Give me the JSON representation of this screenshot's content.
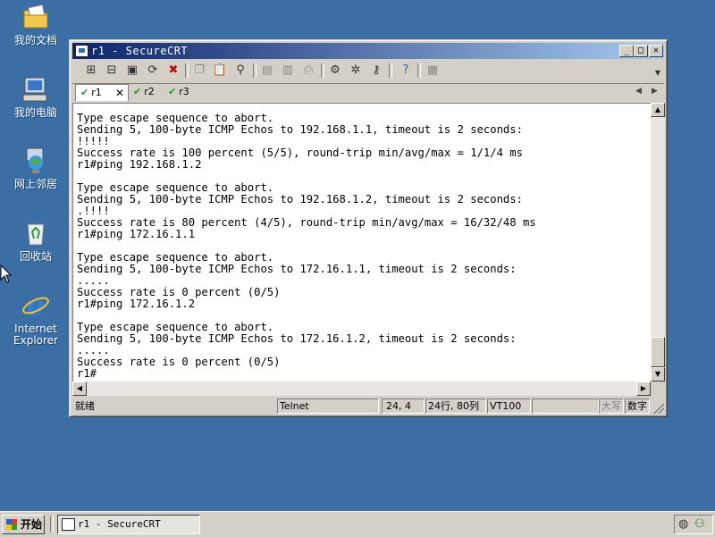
{
  "desktop": {
    "icons": [
      {
        "label": "我的文档",
        "icon": "my-documents-icon"
      },
      {
        "label": "我的电脑",
        "icon": "my-computer-icon"
      },
      {
        "label": "网上邻居",
        "icon": "network-places-icon"
      },
      {
        "label": "回收站",
        "icon": "recycle-bin-icon"
      },
      {
        "label": "Internet Explorer",
        "icon": "internet-explorer-icon"
      }
    ]
  },
  "window": {
    "title": "r1 - SecureCRT",
    "controls": {
      "minimize": "_",
      "maximize": "□",
      "close": "✕"
    }
  },
  "toolbar": {
    "icons": [
      "connect-icon",
      "quick-connect-icon",
      "connect-in-tab-icon",
      "reconnect-icon",
      "disconnect-icon",
      "copy-icon",
      "paste-icon",
      "find-icon",
      "print-icon",
      "print-preview-icon",
      "print-setup-icon",
      "session-options-icon",
      "global-options-icon",
      "keymap-icon",
      "help-icon",
      "keypad-icon"
    ]
  },
  "tabs": [
    {
      "label": "r1",
      "active": true,
      "close": "✕"
    },
    {
      "label": "r2",
      "active": false
    },
    {
      "label": "r3",
      "active": false
    }
  ],
  "terminal": {
    "lines": [
      "Type escape sequence to abort.",
      "Sending 5, 100-byte ICMP Echos to 192.168.1.1, timeout is 2 seconds:",
      "!!!!!",
      "Success rate is 100 percent (5/5), round-trip min/avg/max = 1/1/4 ms",
      "r1#ping 192.168.1.2",
      "",
      "Type escape sequence to abort.",
      "Sending 5, 100-byte ICMP Echos to 192.168.1.2, timeout is 2 seconds:",
      ".!!!!",
      "Success rate is 80 percent (4/5), round-trip min/avg/max = 16/32/48 ms",
      "r1#ping 172.16.1.1",
      "",
      "Type escape sequence to abort.",
      "Sending 5, 100-byte ICMP Echos to 172.16.1.1, timeout is 2 seconds:",
      ".....",
      "Success rate is 0 percent (0/5)",
      "r1#ping 172.16.1.2",
      "",
      "Type escape sequence to abort.",
      "Sending 5, 100-byte ICMP Echos to 172.16.1.2, timeout is 2 seconds:",
      ".....",
      "Success rate is 0 percent (0/5)",
      "r1#"
    ]
  },
  "statusbar": {
    "ready": "就绪",
    "protocol": "Telnet",
    "cursor": "24,  4",
    "size": "24行, 80列",
    "emulation": "VT100",
    "caps": "大写",
    "num": "数字"
  },
  "taskbar": {
    "start": "开始",
    "task": "r1 - SecureCRT"
  }
}
